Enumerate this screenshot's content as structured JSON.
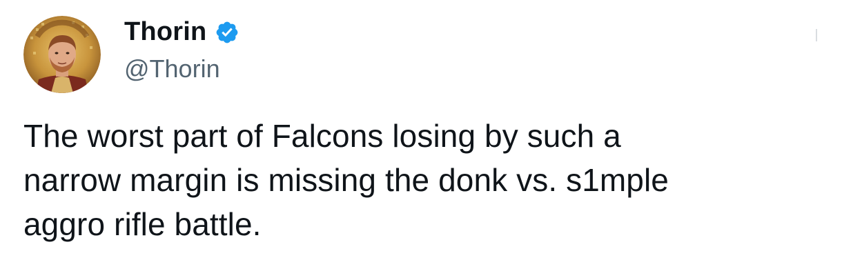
{
  "tweet": {
    "author": {
      "display_name": "Thorin",
      "handle": "@Thorin",
      "verified": true,
      "verified_color": "#1d9bf0",
      "avatar_icon": "avatar-portrait-mosaic"
    },
    "text": "The worst part of Falcons losing by such a\nnarrow margin is missing the donk vs. s1mple\naggro rifle battle."
  },
  "colors": {
    "text_primary": "#0f1419",
    "text_secondary": "#536471",
    "background": "#ffffff"
  }
}
